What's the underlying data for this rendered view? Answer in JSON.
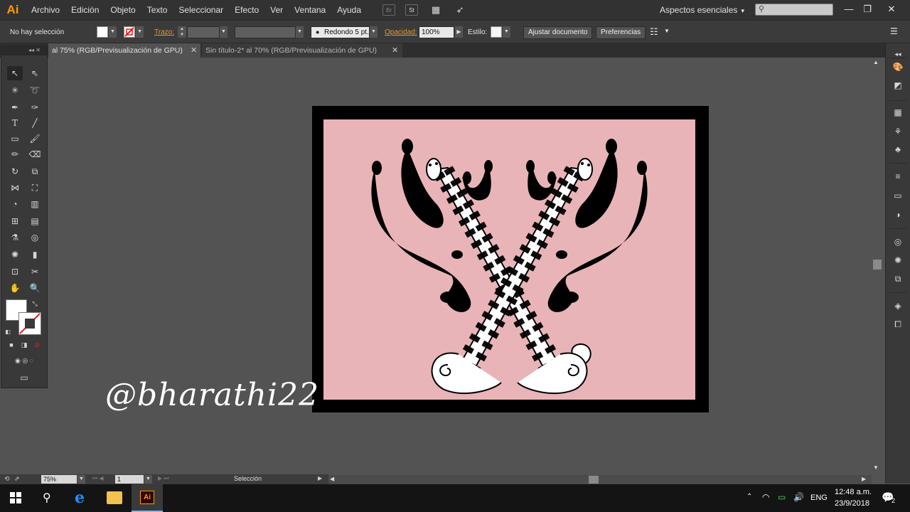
{
  "app": {
    "logo": "Ai",
    "menu": [
      "Archivo",
      "Edición",
      "Objeto",
      "Texto",
      "Seleccionar",
      "Efecto",
      "Ver",
      "Ventana",
      "Ayuda"
    ],
    "menu_icons": {
      "bridge": "Br",
      "stock": "St"
    },
    "workspace": "Aspectos esenciales",
    "window_buttons": {
      "minimize": "—",
      "restore": "❐",
      "close": "✕"
    }
  },
  "control_bar": {
    "selection_status": "No hay selección",
    "stroke_label": "Trazo:",
    "brush_label": "Redondo 5 pt.",
    "opacity_label": "Opacidad:",
    "opacity_value": "100%",
    "style_label": "Estilo:",
    "fit_button": "Ajustar documento",
    "prefs_button": "Preferencias"
  },
  "tabs": [
    {
      "label": "al 75% (RGB/Previsualización de GPU)",
      "active": true
    },
    {
      "label": "Sin título-2* al 70% (RGB/Previsualización de GPU)",
      "active": false
    }
  ],
  "status_bar": {
    "zoom": "75%",
    "artboard": "1",
    "tool_status": "Selección"
  },
  "watermark": "@bharathi22",
  "taskbar": {
    "language": "ENG",
    "time": "12:48 a.m.",
    "date": "23/9/2018",
    "notifications": "2"
  },
  "colors": {
    "artboard_bg": "#e9b4b7",
    "accent": "#ff9a00"
  }
}
